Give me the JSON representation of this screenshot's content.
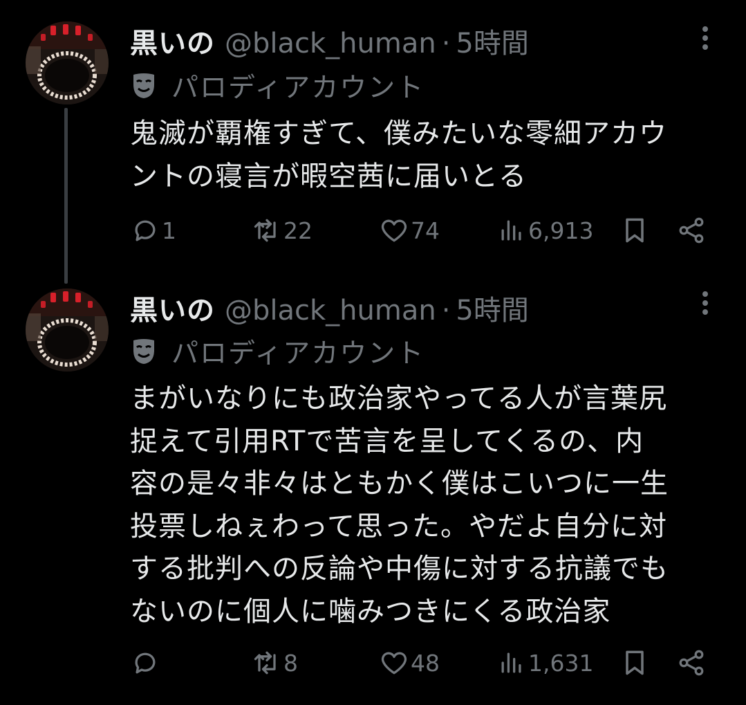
{
  "tweets": [
    {
      "display_name": "黒いの",
      "handle": "@black_human",
      "separator": "·",
      "time": "5時間",
      "label": "パロディアカウント",
      "text": "鬼滅が覇権すぎて、僕みたいな零細アカウ\nントの寝言が暇空茜に届いとる",
      "replies": "1",
      "retweets": "22",
      "likes": "74",
      "views": "6,913"
    },
    {
      "display_name": "黒いの",
      "handle": "@black_human",
      "separator": "·",
      "time": "5時間",
      "label": "パロディアカウント",
      "text": "まがいなりにも政治家やってる人が言葉尻\n捉えて引用RTで苦言を呈してくるの、内\n容の是々非々はともかく僕はこいつに一生\n投票しねぇわって思った。やだよ自分に対\nする批判への反論や中傷に対する抗議でも\nないのに個人に噛みつきにくる政治家",
      "replies": "",
      "retweets": "8",
      "likes": "48",
      "views": "1,631"
    }
  ],
  "colors": {
    "background": "#000000",
    "primary_text": "#e7e9ea",
    "secondary_text": "#71767b",
    "thread_line": "#3a3e42"
  },
  "icons": [
    "more-icon",
    "parody-mask-icon",
    "reply-icon",
    "retweet-icon",
    "like-icon",
    "views-icon",
    "bookmark-icon",
    "share-icon"
  ]
}
